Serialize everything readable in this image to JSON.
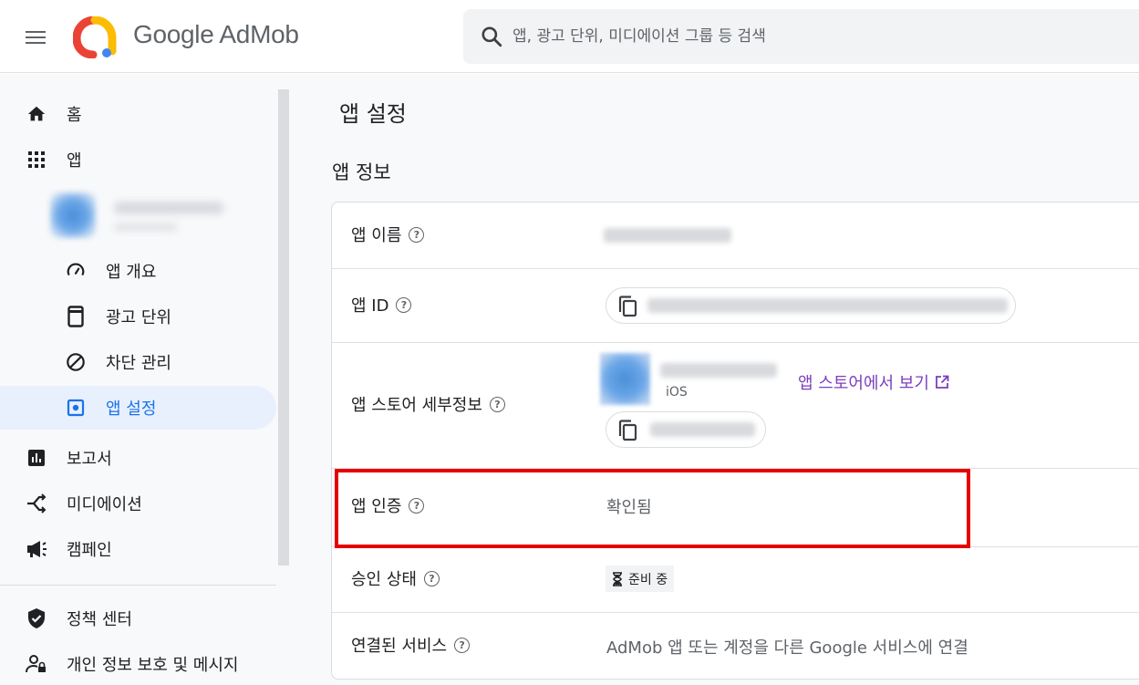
{
  "header": {
    "brand": "Google AdMob",
    "search_placeholder": "앱, 광고 단위, 미디에이션 그룹 등 검색"
  },
  "sidebar": {
    "items": [
      {
        "label": "홈",
        "icon": "home-icon"
      },
      {
        "label": "앱",
        "icon": "apps-grid-icon"
      },
      {
        "label": "앱 개요",
        "icon": "speedometer-icon"
      },
      {
        "label": "광고 단위",
        "icon": "ad-unit-icon"
      },
      {
        "label": "차단 관리",
        "icon": "block-icon"
      },
      {
        "label": "앱 설정",
        "icon": "settings-icon",
        "active": true
      },
      {
        "label": "보고서",
        "icon": "report-icon"
      },
      {
        "label": "미디에이션",
        "icon": "mediation-icon"
      },
      {
        "label": "캠페인",
        "icon": "campaign-icon"
      },
      {
        "label": "정책 센터",
        "icon": "shield-icon"
      },
      {
        "label": "개인 정보 보호 및 메시지",
        "icon": "privacy-icon"
      }
    ]
  },
  "main": {
    "page_title": "앱 설정",
    "section_title": "앱 정보",
    "rows": {
      "app_name": {
        "label": "앱 이름"
      },
      "app_id": {
        "label": "앱 ID"
      },
      "store_details": {
        "label": "앱 스토어 세부정보",
        "platform": "iOS",
        "store_link": "앱 스토어에서 보기"
      },
      "verification": {
        "label": "앱 인증",
        "value": "확인됨"
      },
      "approval": {
        "label": "승인 상태",
        "value": "준비 중"
      },
      "linked_services": {
        "label": "연결된 서비스",
        "value": "AdMob 앱 또는 계정을 다른 Google 서비스에 연결"
      }
    }
  },
  "colors": {
    "accent": "#1a73e8",
    "link": "#7b3fbf",
    "highlight": "#e60000"
  }
}
